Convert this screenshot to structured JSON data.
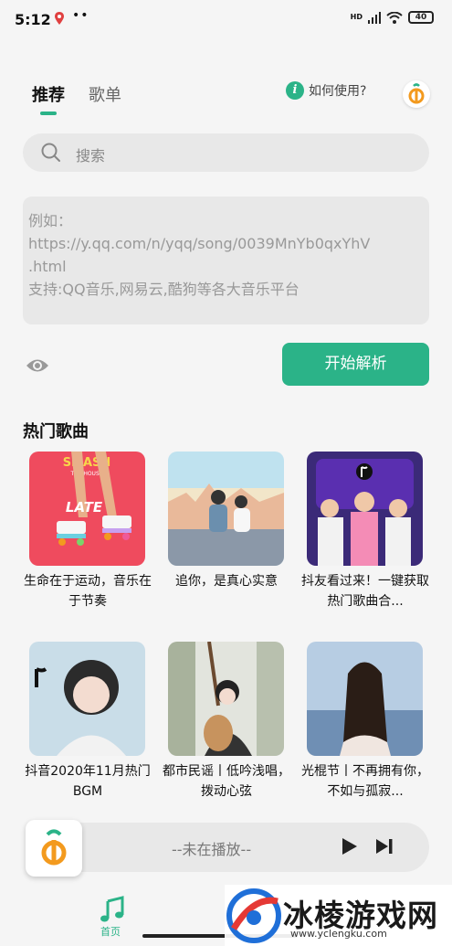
{
  "status": {
    "time": "5:12",
    "dots": "••",
    "network": "HD",
    "battery": "40"
  },
  "tabs": [
    {
      "label": "推荐",
      "active": true
    },
    {
      "label": "歌单",
      "active": false
    }
  ],
  "help": {
    "icon": "i",
    "label": "如何使用?"
  },
  "search": {
    "placeholder": "搜索"
  },
  "url_box": {
    "lines": [
      "例如：",
      "https://y.qq.com/n/yqq/song/0039MnYb0qxYhV",
      ".html",
      " 支持:QQ音乐,网易云,酷狗等各大音乐平台"
    ]
  },
  "parse_button": "开始解析",
  "hot_songs": {
    "title": "热门歌曲",
    "items": [
      {
        "title": "生命在于运动，音乐在于节奏",
        "cover_text": [
          "SMASH",
          "THE HOUSE",
          "LATE"
        ]
      },
      {
        "title": "追你，是真心实意"
      },
      {
        "title": "抖友看过来！一键获取热门歌曲合..."
      },
      {
        "title": "抖音2020年11月热门BGM"
      },
      {
        "title": "都市民谣丨低吟浅唱，拨动心弦"
      },
      {
        "title": "光棍节丨不再拥有你，不如与孤寂..."
      }
    ]
  },
  "player": {
    "status": "--未在播放--"
  },
  "nav": {
    "home_label": "首页"
  },
  "watermark": {
    "text": "冰棱游戏网",
    "url": "www.yclengku.com"
  },
  "colors": {
    "accent": "#2bb388",
    "logo_orange": "#f39a1e"
  }
}
